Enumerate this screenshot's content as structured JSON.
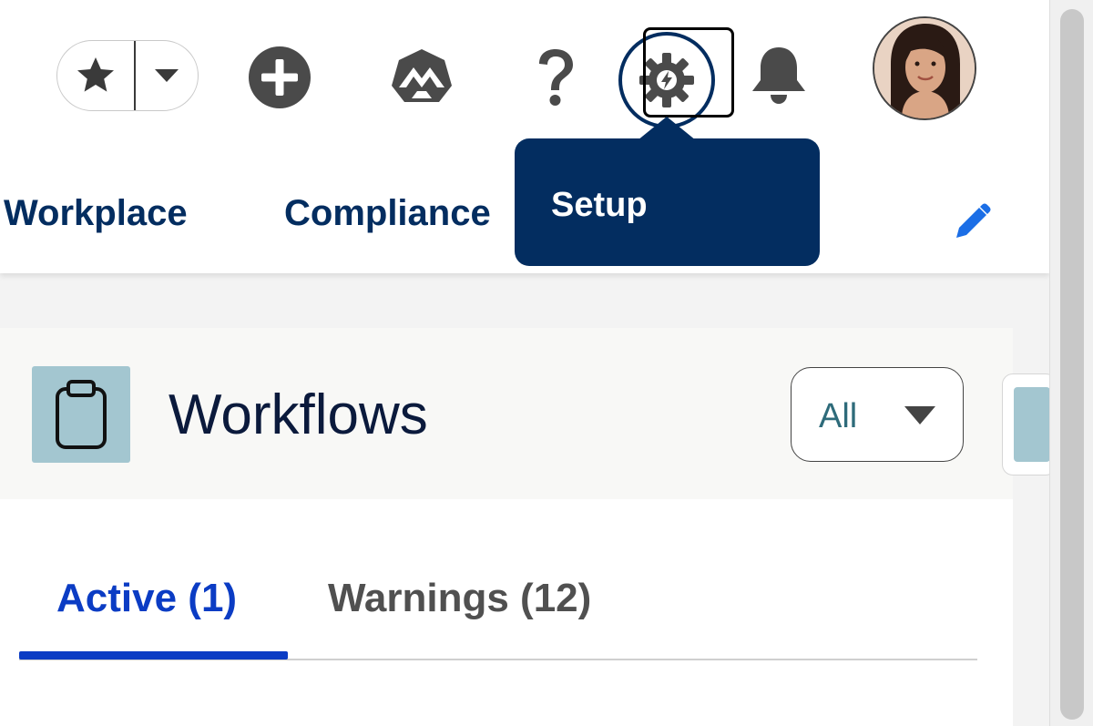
{
  "header": {
    "favorites_icon": "star-icon",
    "favorites_menu_icon": "chevron-down-icon",
    "add_icon": "plus-circle-icon",
    "trailhead_icon": "trailhead-icon",
    "help_icon": "question-icon",
    "setup_icon": "gear-lightning-icon",
    "notifications_icon": "bell-icon"
  },
  "tooltip": {
    "text": "Setup"
  },
  "nav": {
    "items": [
      {
        "label": "Workplace"
      },
      {
        "label": "Compliance"
      }
    ],
    "edit_icon": "pencil-icon"
  },
  "card": {
    "title": "Workflows",
    "icon": "clipboard-icon",
    "filter": {
      "selected": "All"
    },
    "tabs": [
      {
        "label": "Active (1)",
        "active": true
      },
      {
        "label": "Warnings (12)",
        "active": false
      }
    ]
  },
  "colors": {
    "navy": "#032d60",
    "active_blue": "#0b3cc4",
    "icon_gray": "#4a4a4a",
    "accent_blue": "#1b6ee6",
    "icon_tile": "#a3c6d0"
  }
}
